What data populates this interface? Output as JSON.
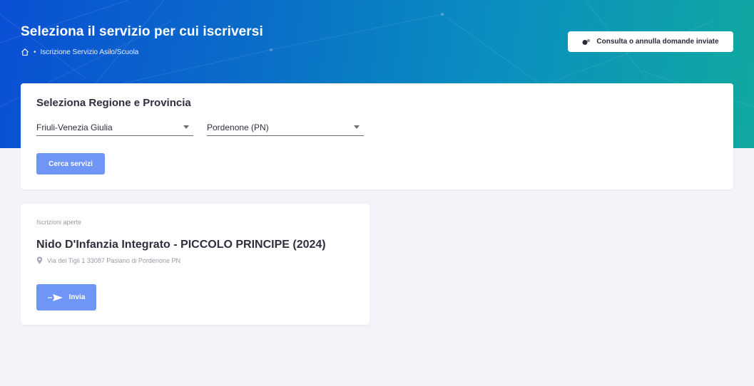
{
  "header": {
    "title": "Seleziona il servizio per cui iscriversi",
    "breadcrumb": {
      "home_icon": "home-icon",
      "separator": "•",
      "current": "Iscrizione Servizio Asilo/Scuola"
    },
    "consult_button": {
      "icon": "toggle-icon",
      "label": "Consulta o annulla domande inviate"
    }
  },
  "region_card": {
    "title": "Seleziona Regione e Provincia",
    "region_select": {
      "value": "Friuli-Venezia Giulia"
    },
    "province_select": {
      "value": "Pordenone (PN)"
    },
    "search_button": "Cerca servizi"
  },
  "service_card": {
    "status": "Iscrizioni aperte",
    "name": "Nido D'Infanzia Integrato - PICCOLO PRINCIPE (2024)",
    "address": "Via dei Tigli 1 33087 Pasiano di Pordenone PN",
    "address_icon": "map-pin-icon",
    "send_button": {
      "icon": "send-icon",
      "label": "Invia"
    }
  },
  "colors": {
    "primary_button": "#6f95f7",
    "hero_start": "#0a4fd4",
    "hero_end": "#10a9a0",
    "background": "#f3f4f9"
  }
}
